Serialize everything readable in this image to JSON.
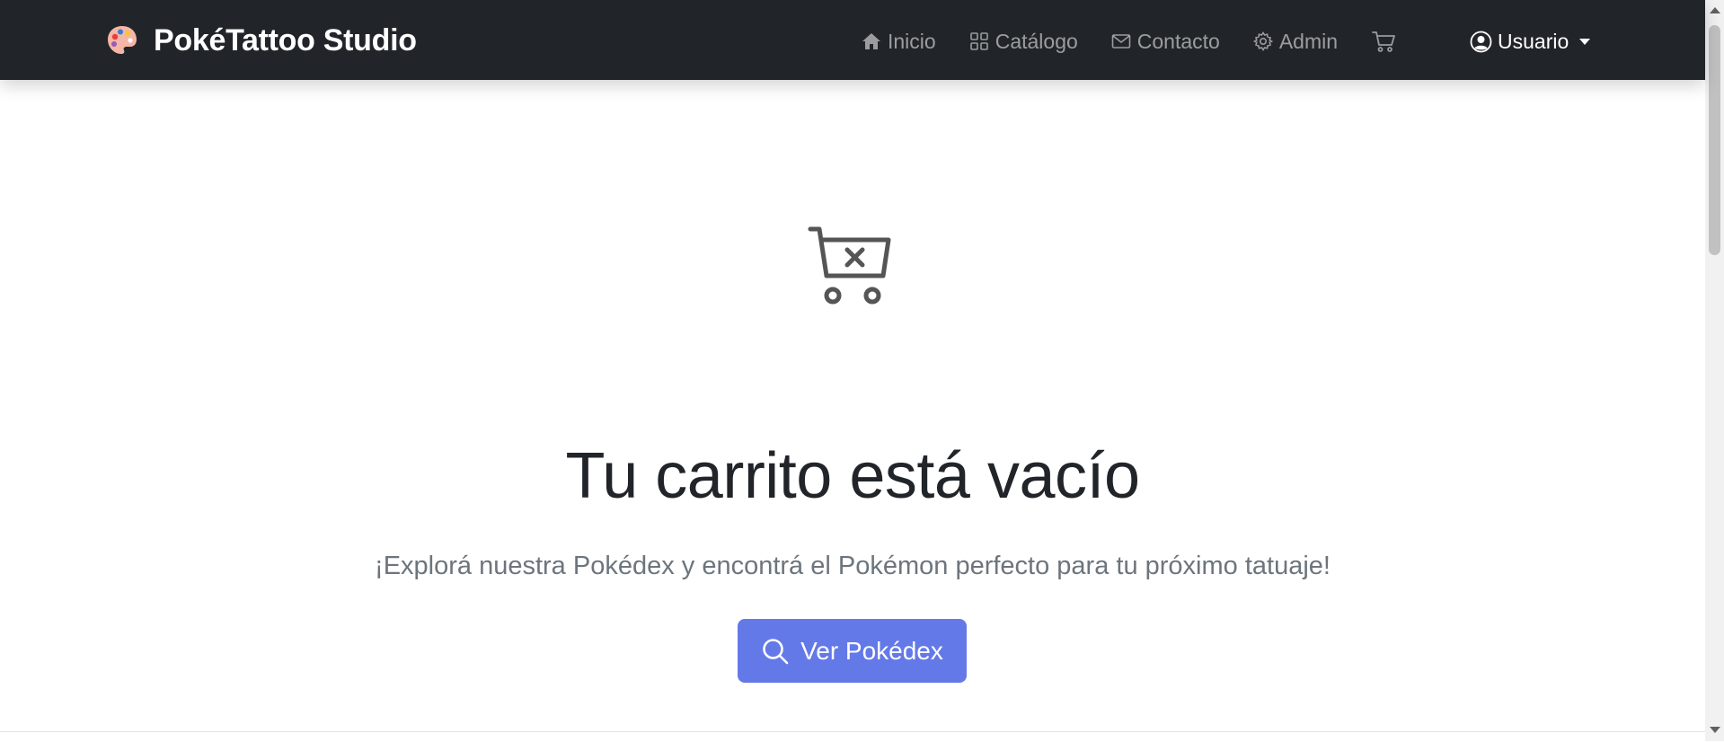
{
  "brand": {
    "name": "PokéTattoo Studio",
    "icon": "palette-icon"
  },
  "nav": {
    "items": [
      {
        "label": "Inicio",
        "icon": "house-icon"
      },
      {
        "label": "Catálogo",
        "icon": "grid-icon"
      },
      {
        "label": "Contacto",
        "icon": "envelope-icon"
      },
      {
        "label": "Admin",
        "icon": "gear-icon"
      }
    ],
    "cart_icon": "cart-icon",
    "user_label": "Usuario",
    "user_icon": "user-circle-icon"
  },
  "empty_state": {
    "icon": "cart-x-icon",
    "title": "Tu carrito está vacío",
    "subtitle": "¡Explorá nuestra Pokédex y encontrá el Pokémon perfecto para tu próximo tatuaje!",
    "button_label": "Ver Pokédex",
    "button_icon": "search-icon"
  },
  "colors": {
    "navbar_bg": "#212529",
    "accent": "#6479e8",
    "muted_text": "#6c757d",
    "nav_link": "rgba(255,255,255,0.55)"
  }
}
